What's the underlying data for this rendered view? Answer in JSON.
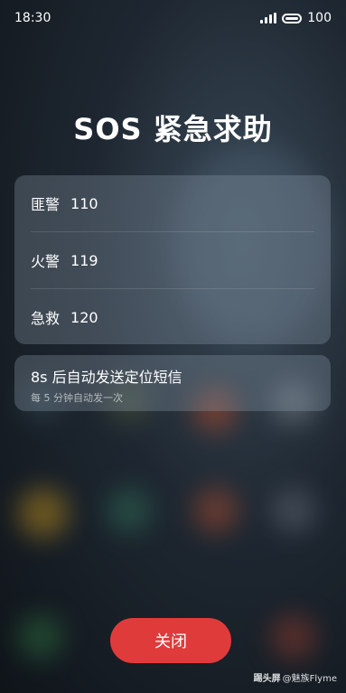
{
  "status_bar": {
    "time": "18:30",
    "battery": "100",
    "signal_icon": "signal-icon",
    "battery_icon": "battery-icon"
  },
  "title": "SOS 紧急求助",
  "emergency_calls": [
    {
      "label": "匪警",
      "number": "110"
    },
    {
      "label": "火警",
      "number": "119"
    },
    {
      "label": "急救",
      "number": "120"
    }
  ],
  "sms": {
    "title": "8s 后自动发送定位短信",
    "subtitle": "每 5 分钟自动发一次"
  },
  "close_button": "关闭",
  "watermark": {
    "brand": "踢头屏",
    "text": "@魅族Flyme"
  },
  "colors": {
    "close_button": "#e03b3b"
  }
}
